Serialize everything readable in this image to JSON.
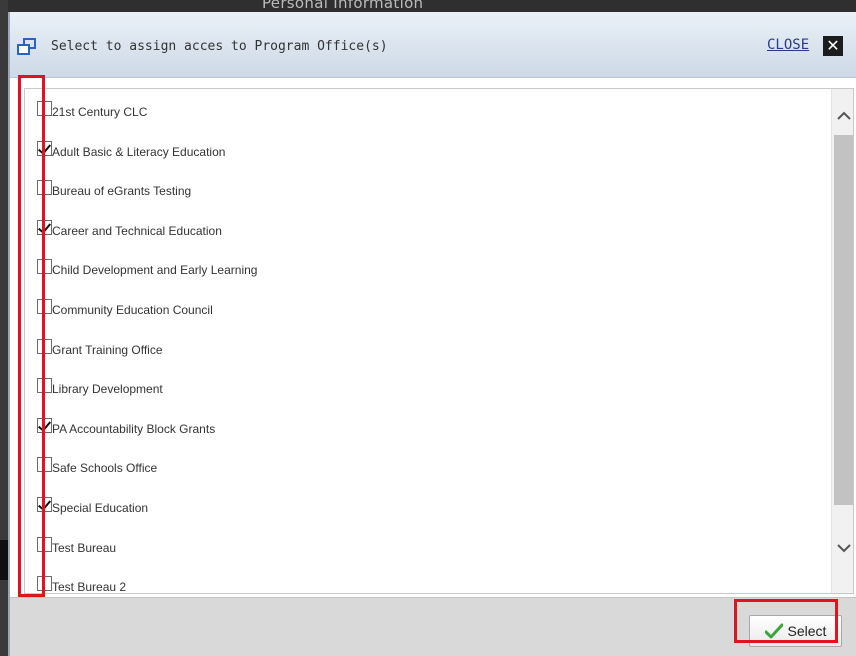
{
  "background": {
    "peek_text": "Personal Information"
  },
  "dialog": {
    "title": "Select to assign acces to Program Office(s)",
    "close_label": "CLOSE",
    "close_icon": "x-icon",
    "title_icon": "popup-window-icon"
  },
  "list": {
    "items": [
      {
        "label": "21st Century CLC",
        "checked": false
      },
      {
        "label": "Adult Basic & Literacy Education",
        "checked": true
      },
      {
        "label": "Bureau of eGrants Testing",
        "checked": false
      },
      {
        "label": "Career and Technical Education",
        "checked": true
      },
      {
        "label": "Child Development and Early Learning",
        "checked": false
      },
      {
        "label": "Community Education Council",
        "checked": false
      },
      {
        "label": "Grant Training Office",
        "checked": false
      },
      {
        "label": "Library Development",
        "checked": false
      },
      {
        "label": "PA Accountability Block Grants",
        "checked": true
      },
      {
        "label": "Safe Schools Office",
        "checked": false
      },
      {
        "label": "Special Education",
        "checked": true
      },
      {
        "label": "Test Bureau",
        "checked": false
      },
      {
        "label": "Test Bureau 2",
        "checked": false
      }
    ]
  },
  "footer": {
    "select_label": "Select",
    "select_icon": "green-check-icon"
  },
  "colors": {
    "highlight": "#e0141c",
    "titlebar": "#cdd9e6",
    "footer": "#d9d9d9"
  }
}
